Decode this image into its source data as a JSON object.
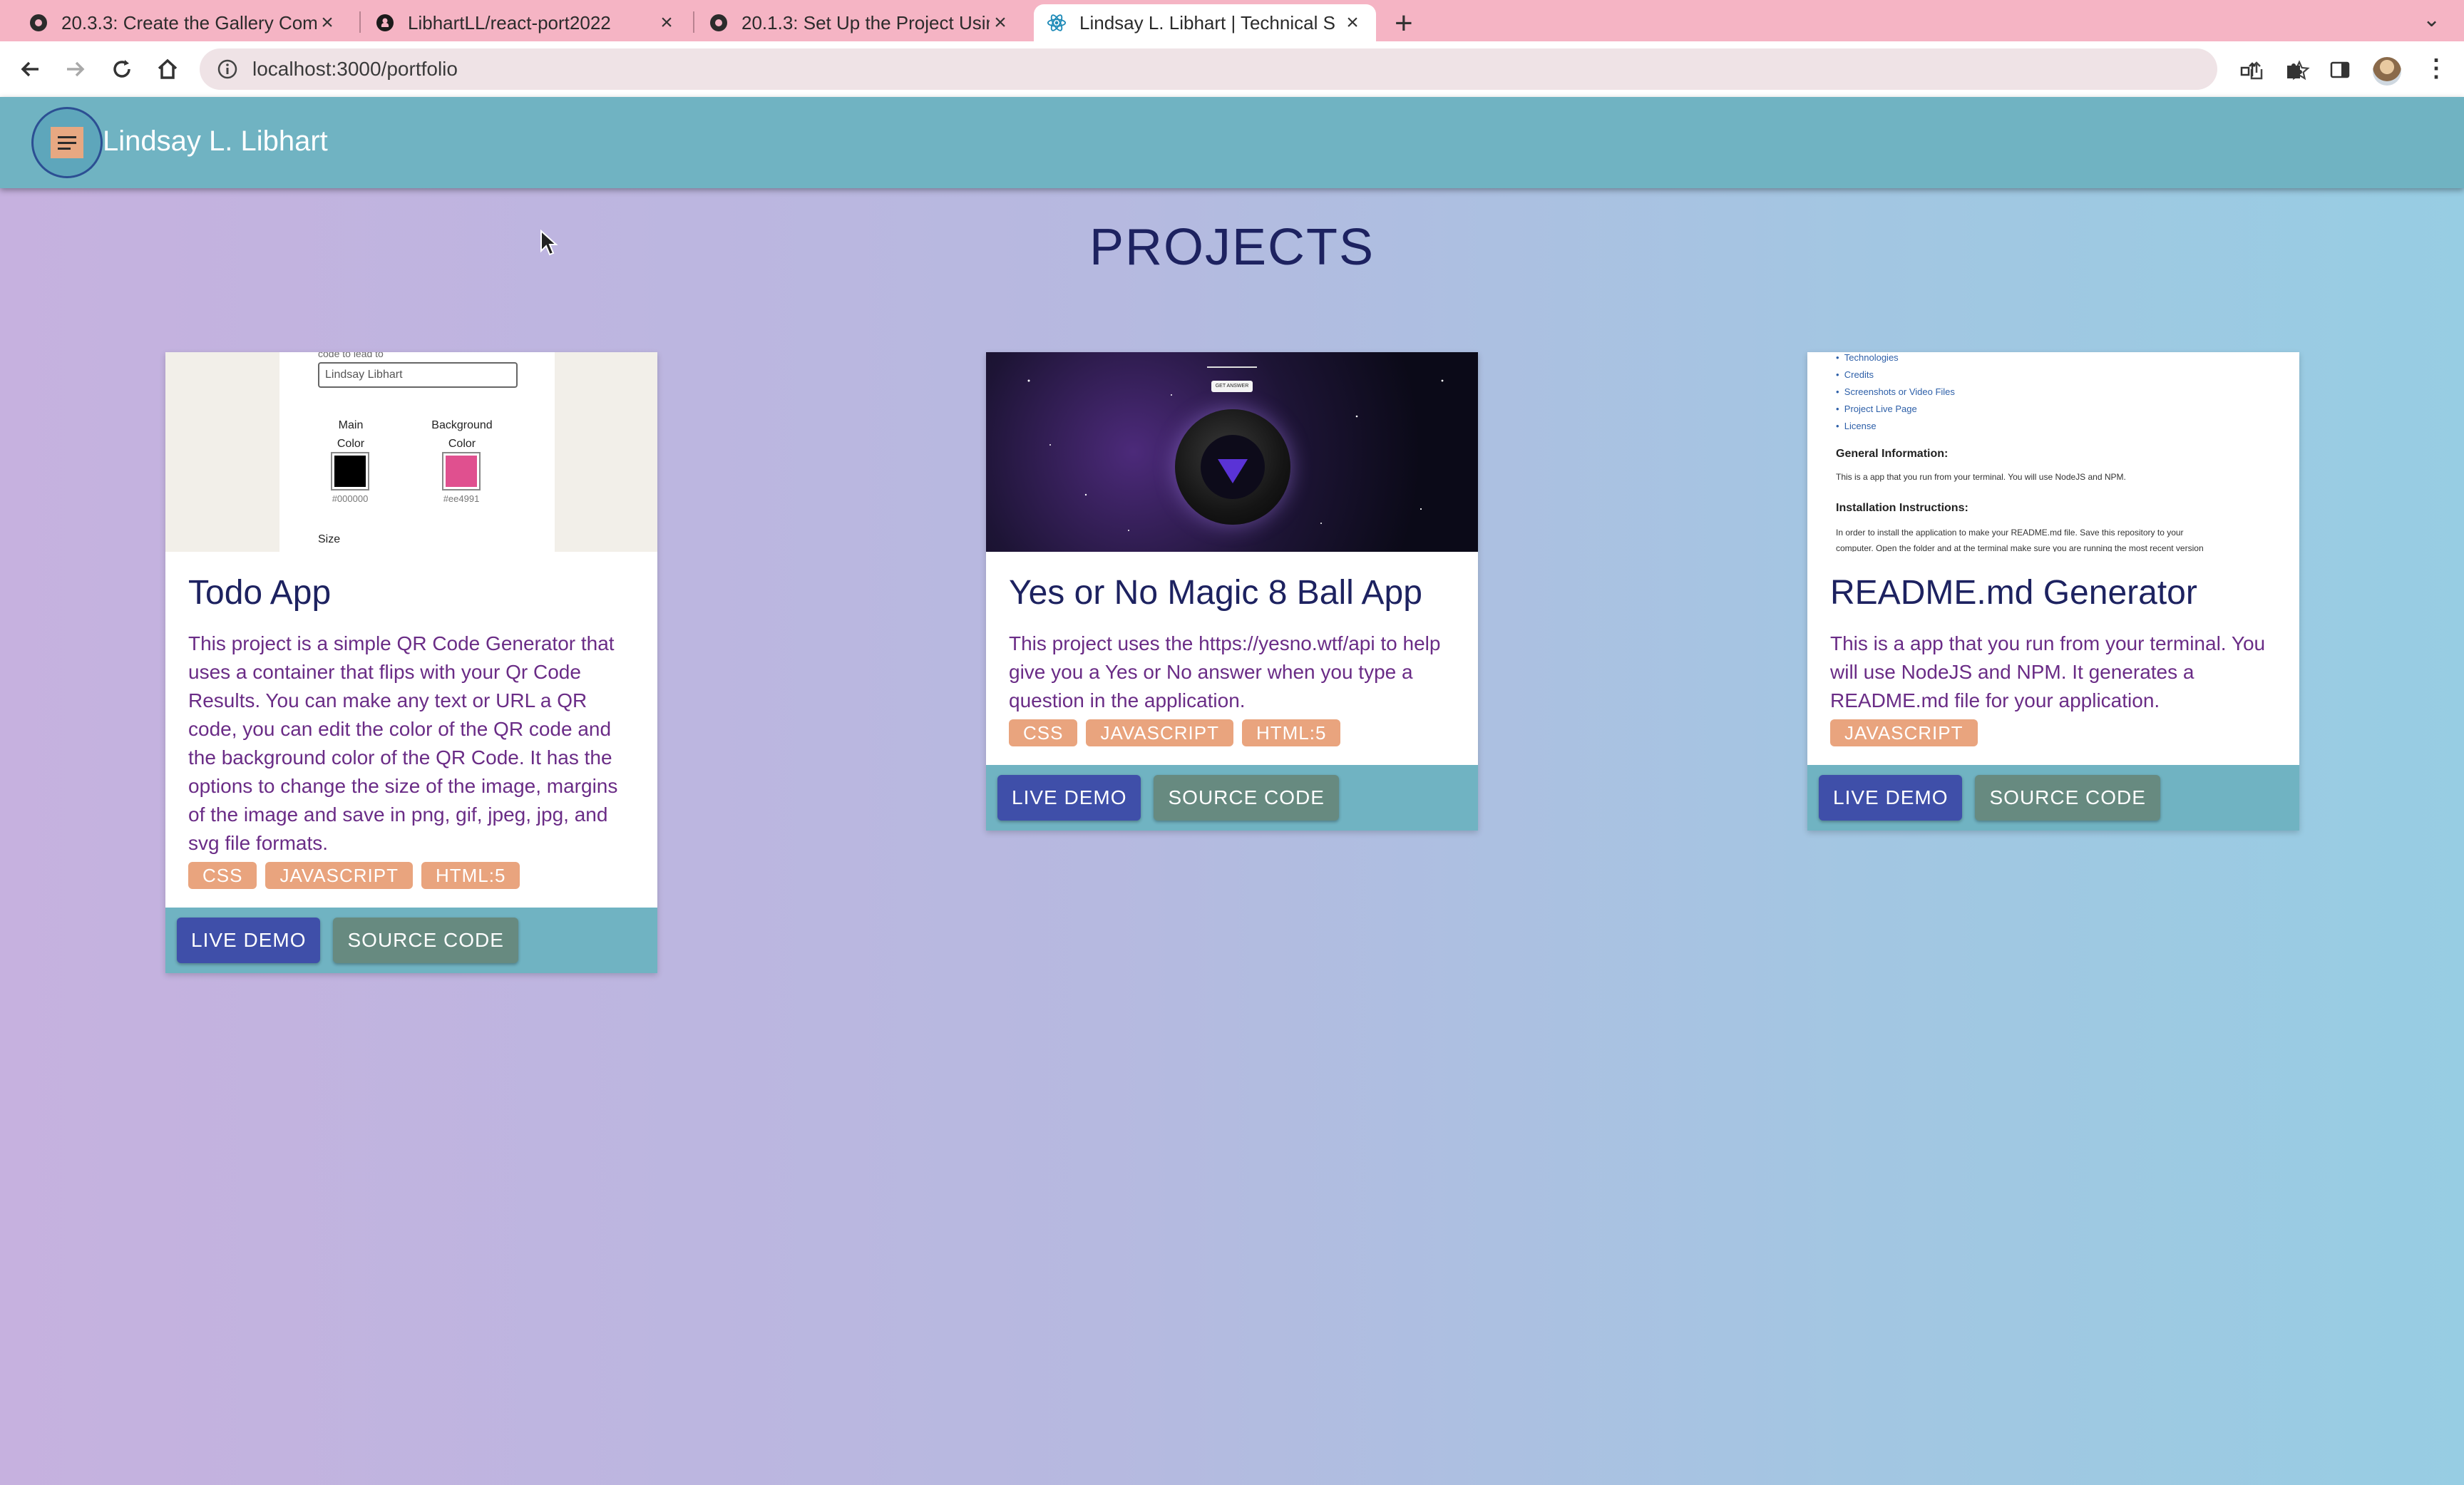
{
  "browser": {
    "tabs": [
      {
        "title": "20.3.3: Create the Gallery Com",
        "favicon": "canvas-icon",
        "active": false
      },
      {
        "title": "LibhartLL/react-port2022",
        "favicon": "github-icon",
        "active": false
      },
      {
        "title": "20.1.3: Set Up the Project Usin",
        "favicon": "canvas-icon",
        "active": false
      },
      {
        "title": "Lindsay L. Libhart | Technical S",
        "favicon": "react-icon",
        "active": true
      }
    ],
    "new_tab_label": "+",
    "url": "localhost:3000/portfolio"
  },
  "header": {
    "site_name": "Lindsay L. Libhart",
    "colors": {
      "bar": "#70b3c2",
      "menu_square": "#e7a882"
    }
  },
  "main": {
    "heading": "PROJECTS",
    "projects": [
      {
        "title": "Todo App",
        "description": "This project is a simple QR Code Generator that uses a container that flips with your Qr Code Results. You can make any text or URL a QR code, you can edit the color of the QR code and the background color of the QR Code. It has the options to change the size of the image, margins of the image and save in png, gif, jpeg, jpg, and svg file formats.",
        "tags": [
          "CSS",
          "JAVASCRIPT",
          "HTML:5"
        ],
        "live_label": "LIVE DEMO",
        "source_label": "SOURCE CODE",
        "thumb": {
          "top_text": "code to lead to",
          "input_value": "Lindsay Libhart",
          "main_color_label_1": "Main",
          "main_color_label_2": "Color",
          "bg_color_label_1": "Background",
          "bg_color_label_2": "Color",
          "main_hex": "#000000",
          "bg_hex": "#ee4991",
          "size_label": "Size",
          "main_swatch": "#000000",
          "bg_swatch": "#e0508f"
        }
      },
      {
        "title": "Yes or No Magic 8 Ball App",
        "description": "This project uses the https://yesno.wtf/api to help give you a Yes or No answer when you type a question in the application.",
        "tags": [
          "CSS",
          "JAVASCRIPT",
          "HTML:5"
        ],
        "live_label": "LIVE DEMO",
        "source_label": "SOURCE CODE",
        "thumb": {
          "button_text": "GET ANSWER"
        }
      },
      {
        "title": "README.md Generator",
        "description": "This is a app that you run from your terminal. You will use NodeJS and NPM. It generates a README.md file for your application.",
        "tags": [
          "JAVASCRIPT"
        ],
        "live_label": "LIVE DEMO",
        "source_label": "SOURCE CODE",
        "thumb": {
          "links": [
            "Technologies",
            "Credits",
            "Screenshots or Video Files",
            "Project Live Page",
            "License"
          ],
          "general_heading": "General Information:",
          "general_text": "This is a app that you run from your terminal. You will use NodeJS and NPM.",
          "install_heading": "Installation Instructions:",
          "install_text_1": "In order to install the application to make your README.md file. Save this repository to your",
          "install_text_2": "computer. Open the folder and at the terminal make sure you are running the most recent version"
        }
      }
    ]
  },
  "colors": {
    "accent_orange": "#e9a47e",
    "demo_button": "#3f4fa9",
    "source_button": "#678a80",
    "heading_navy": "#1d2260",
    "description_purple": "#6a2c86"
  }
}
